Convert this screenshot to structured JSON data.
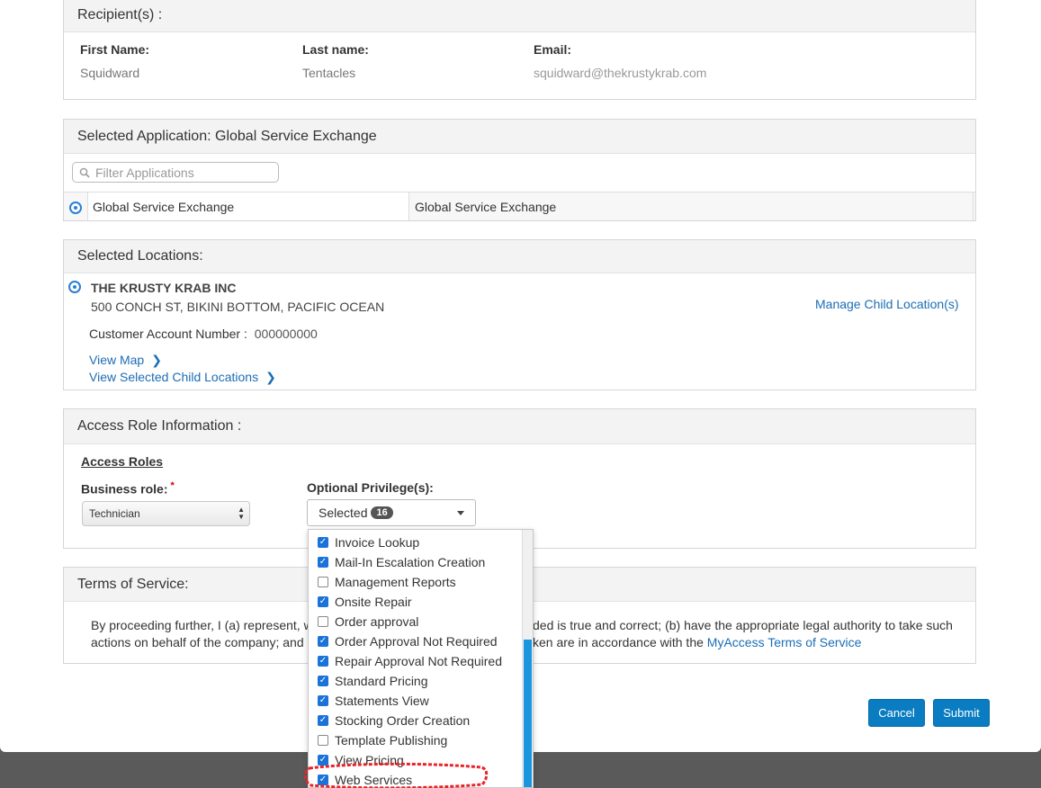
{
  "recipients": {
    "title": "Recipient(s) :",
    "first_name_label": "First Name:",
    "first_name": "Squidward",
    "last_name_label": "Last name:",
    "last_name": "Tentacles",
    "email_label": "Email:",
    "email": "squidward@thekrustykrab.com"
  },
  "application": {
    "title": "Selected Application: Global Service Exchange",
    "filter_placeholder": "Filter Applications",
    "row_name": "Global Service Exchange",
    "row_desc": "Global Service Exchange"
  },
  "locations": {
    "title": "Selected Locations:",
    "company": "THE KRUSTY KRAB INC",
    "address": "500 CONCH ST, BIKINI BOTTOM, PACIFIC OCEAN",
    "account_label": "Customer Account Number :",
    "account_number": "000000000",
    "view_map": "View Map",
    "view_children": "View Selected Child Locations",
    "manage_children": "Manage Child Location(s)"
  },
  "access": {
    "title": "Access Role Information :",
    "roles_heading": "Access Roles",
    "business_role_label": "Business role:",
    "required_mark": "*",
    "business_role_value": "Technician",
    "privileges_label": "Optional Privilege(s):",
    "privileges_selected_label": "Selected",
    "privileges_count": "16"
  },
  "privileges": [
    {
      "label": "Invoice Lookup",
      "checked": true
    },
    {
      "label": "Mail-In Escalation Creation",
      "checked": true
    },
    {
      "label": "Management Reports",
      "checked": false
    },
    {
      "label": "Onsite Repair",
      "checked": true
    },
    {
      "label": "Order approval",
      "checked": false
    },
    {
      "label": "Order Approval Not Required",
      "checked": true
    },
    {
      "label": "Repair Approval Not Required",
      "checked": true
    },
    {
      "label": "Standard Pricing",
      "checked": true
    },
    {
      "label": "Statements View",
      "checked": true
    },
    {
      "label": "Stocking Order Creation",
      "checked": true
    },
    {
      "label": "Template Publishing",
      "checked": false
    },
    {
      "label": "View Pricing",
      "checked": true
    },
    {
      "label": "Web Services",
      "checked": true
    }
  ],
  "terms": {
    "title": "Terms of Service:",
    "line1_left": "By proceeding further, I (a) represent, wa",
    "line1_right": "ded is true and correct; (b) have the appropriate legal authority to take such",
    "line2_left": "actions on behalf of the company; and (",
    "line2_right": "ken are in accordance with the ",
    "link": "MyAccess Terms of Service"
  },
  "buttons": {
    "cancel": "Cancel",
    "submit": "Submit"
  },
  "colors": {
    "primary": "#0a7cc1",
    "link": "#1b6eb5",
    "checkbox": "#1a73d9",
    "highlight": "#e8242b"
  }
}
